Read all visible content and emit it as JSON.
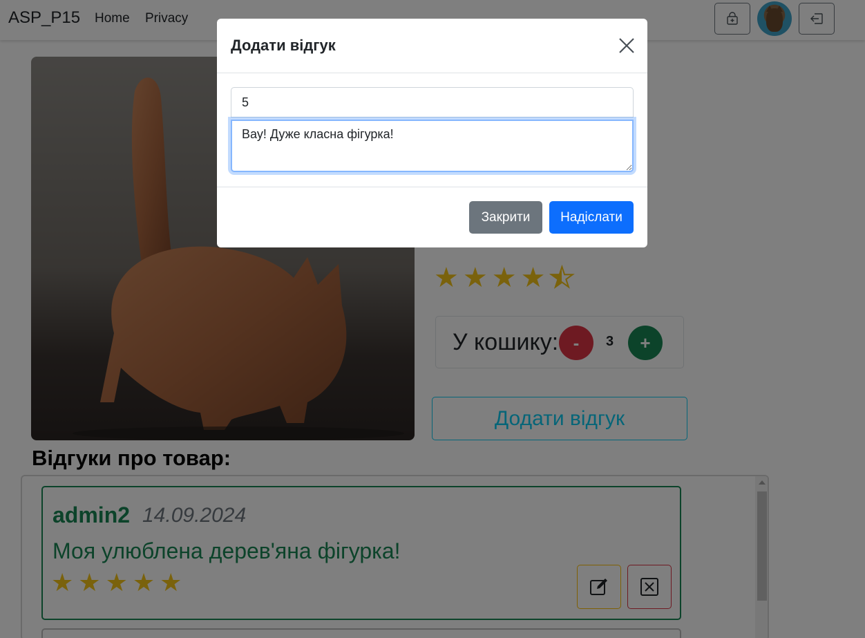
{
  "navbar": {
    "brand": "ASP_P15",
    "links": [
      {
        "label": "Home"
      },
      {
        "label": "Privacy"
      }
    ],
    "icons": {
      "bag": "shopping-bag-icon",
      "logout": "logout-icon"
    }
  },
  "product": {
    "rating_value": 4.5,
    "rating_max": 5,
    "star_glyph": "★",
    "cart": {
      "label": "У кошику:",
      "count": "3",
      "minus": "-",
      "plus": "+"
    },
    "add_review_label": "Додати відгук"
  },
  "reviews": {
    "heading": "Відгуки про товар:",
    "items": [
      {
        "author": "admin2",
        "date": "14.09.2024",
        "text": "Моя улюблена дерев'яна фігурка!",
        "rating": 5
      }
    ]
  },
  "modal": {
    "title": "Додати відгук",
    "rating_value": "5",
    "comment_value": "Вау! Дуже класна фігурка!",
    "close_label": "Закрити",
    "send_label": "Надіслати"
  },
  "colors": {
    "primary": "#0d6efd",
    "secondary": "#6c757d",
    "success": "#198754",
    "danger": "#dc3545",
    "info": "#0dcaf0",
    "warning": "#ffc107",
    "star": "#f5c518"
  }
}
